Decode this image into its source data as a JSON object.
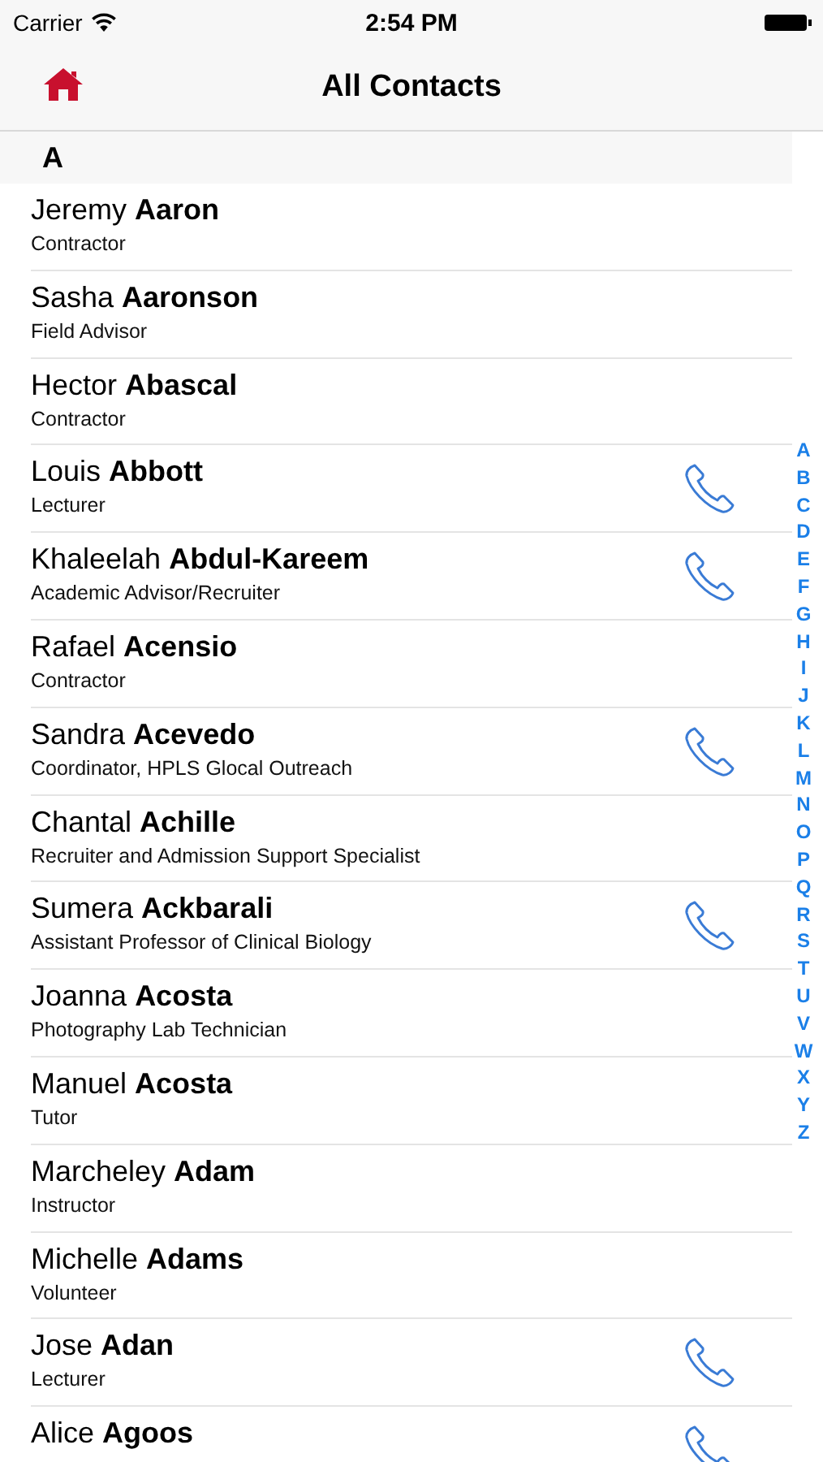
{
  "status_bar": {
    "carrier": "Carrier",
    "time": "2:54 PM"
  },
  "nav": {
    "title": "All Contacts"
  },
  "section": {
    "letter": "A"
  },
  "contacts": [
    {
      "first": "Jeremy",
      "last": "Aaron",
      "role": "Contractor",
      "has_phone": false
    },
    {
      "first": "Sasha",
      "last": "Aaronson",
      "role": "Field Advisor",
      "has_phone": false
    },
    {
      "first": "Hector",
      "last": "Abascal",
      "role": "Contractor",
      "has_phone": false
    },
    {
      "first": "Louis",
      "last": "Abbott",
      "role": "Lecturer",
      "has_phone": true
    },
    {
      "first": "Khaleelah",
      "last": "Abdul-Kareem",
      "role": "Academic Advisor/Recruiter",
      "has_phone": true
    },
    {
      "first": "Rafael",
      "last": "Acensio",
      "role": "Contractor",
      "has_phone": false
    },
    {
      "first": "Sandra",
      "last": "Acevedo",
      "role": "Coordinator, HPLS Glocal Outreach",
      "has_phone": true
    },
    {
      "first": "Chantal",
      "last": "Achille",
      "role": "Recruiter and Admission Support Specialist",
      "has_phone": false
    },
    {
      "first": "Sumera",
      "last": "Ackbarali",
      "role": "Assistant Professor of Clinical Biology",
      "has_phone": true
    },
    {
      "first": "Joanna",
      "last": "Acosta",
      "role": "Photography Lab Technician",
      "has_phone": false
    },
    {
      "first": "Manuel",
      "last": "Acosta",
      "role": "Tutor",
      "has_phone": false
    },
    {
      "first": "Marcheley",
      "last": "Adam",
      "role": "Instructor",
      "has_phone": false
    },
    {
      "first": "Michelle",
      "last": "Adams",
      "role": "Volunteer",
      "has_phone": false
    },
    {
      "first": "Jose",
      "last": "Adan",
      "role": "Lecturer",
      "has_phone": true
    },
    {
      "first": "Alice",
      "last": "Agoos",
      "has_phone": true
    }
  ],
  "index": [
    "A",
    "B",
    "C",
    "D",
    "E",
    "F",
    "G",
    "H",
    "I",
    "J",
    "K",
    "L",
    "M",
    "N",
    "O",
    "P",
    "Q",
    "R",
    "S",
    "T",
    "U",
    "V",
    "W",
    "X",
    "Y",
    "Z"
  ]
}
